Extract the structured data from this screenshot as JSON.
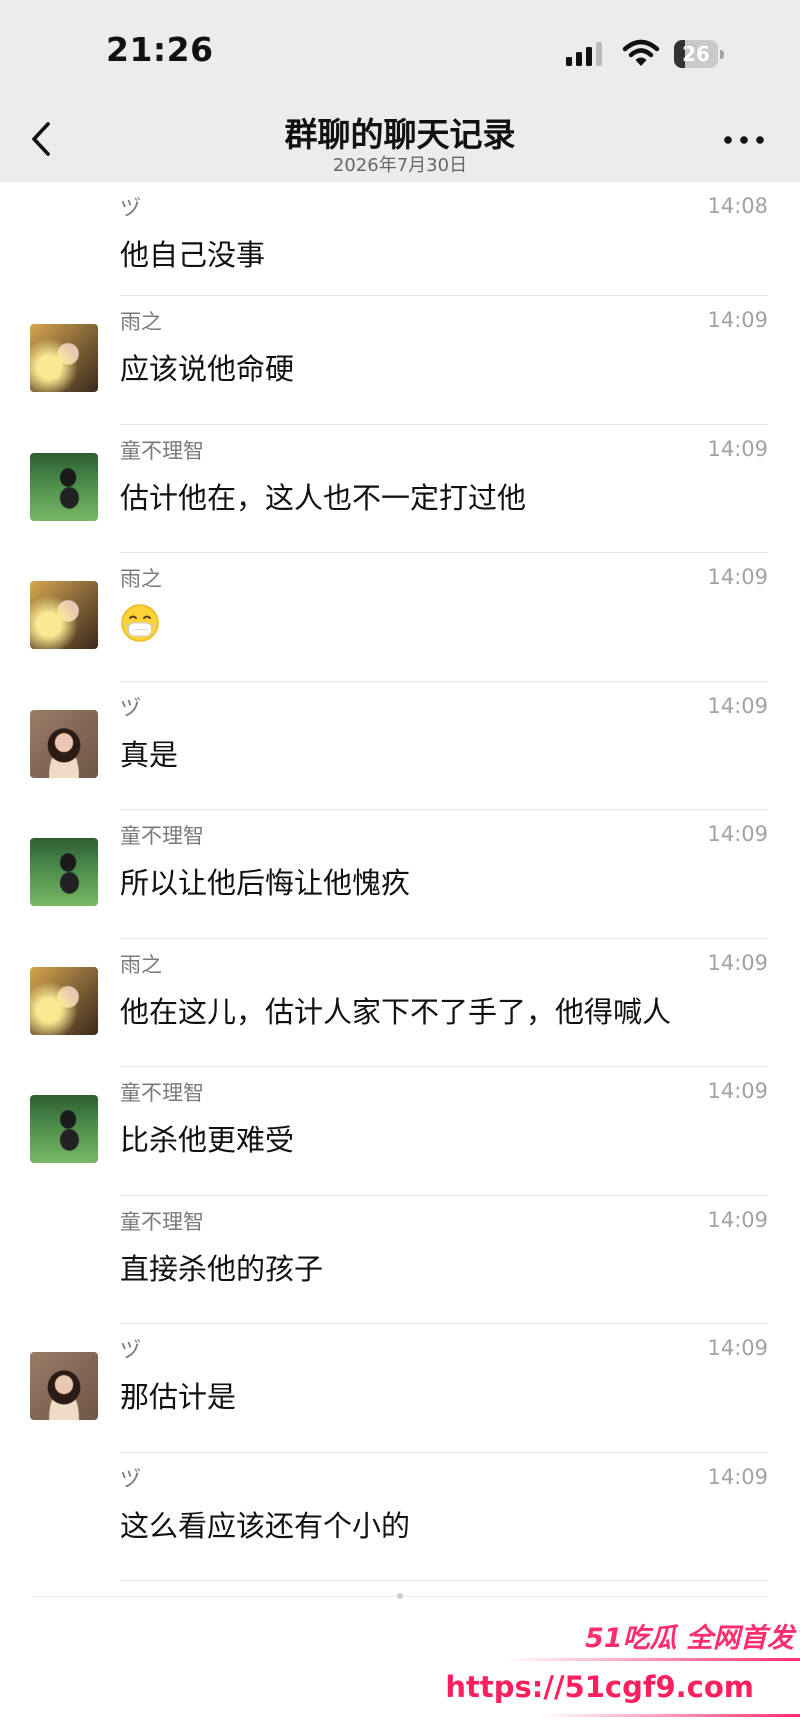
{
  "status_bar": {
    "time": "21:26",
    "battery": "26",
    "battery_level_percent": 26,
    "icons": [
      "cellular-signal-icon",
      "wifi-icon",
      "battery-icon"
    ]
  },
  "nav": {
    "title": "群聊的聊天记录",
    "subtitle": "2026年7月30日",
    "back_icon": "chevron-left-icon",
    "more_icon": "more-dots-icon"
  },
  "messages": [
    {
      "sender": "ヅ",
      "time": "14:08",
      "text": "他自己没事",
      "avatar": null
    },
    {
      "sender": "雨之",
      "time": "14:09",
      "text": "应该说他命硬",
      "avatar": "yuzhi"
    },
    {
      "sender": "童不理智",
      "time": "14:09",
      "text": "估计他在，这人也不一定打过他",
      "avatar": "tong"
    },
    {
      "sender": "雨之",
      "time": "14:09",
      "text": "",
      "emoji": "mask-face-emoji",
      "avatar": "yuzhi"
    },
    {
      "sender": "ヅ",
      "time": "14:09",
      "text": "真是",
      "avatar": "vi"
    },
    {
      "sender": "童不理智",
      "time": "14:09",
      "text": "所以让他后悔让他愧疚",
      "avatar": "tong"
    },
    {
      "sender": "雨之",
      "time": "14:09",
      "text": "他在这儿，估计人家下不了手了，他得喊人",
      "avatar": "yuzhi"
    },
    {
      "sender": "童不理智",
      "time": "14:09",
      "text": "比杀他更难受",
      "avatar": "tong"
    },
    {
      "sender": "童不理智",
      "time": "14:09",
      "text": "直接杀他的孩子",
      "avatar": null
    },
    {
      "sender": "ヅ",
      "time": "14:09",
      "text": "那估计是",
      "avatar": "vi"
    },
    {
      "sender": "ヅ",
      "time": "14:09",
      "text": "这么看应该还有个小的",
      "avatar": null
    }
  ],
  "watermark": {
    "brand": "51吃瓜 全网首发",
    "url": "https://51cgf9.com"
  },
  "colors": {
    "header_bg": "#ececec",
    "sender_text": "#7a7a7a",
    "time_text": "#a2a2a2",
    "divider": "#e6e6e6",
    "watermark": "#ff2d6b"
  }
}
